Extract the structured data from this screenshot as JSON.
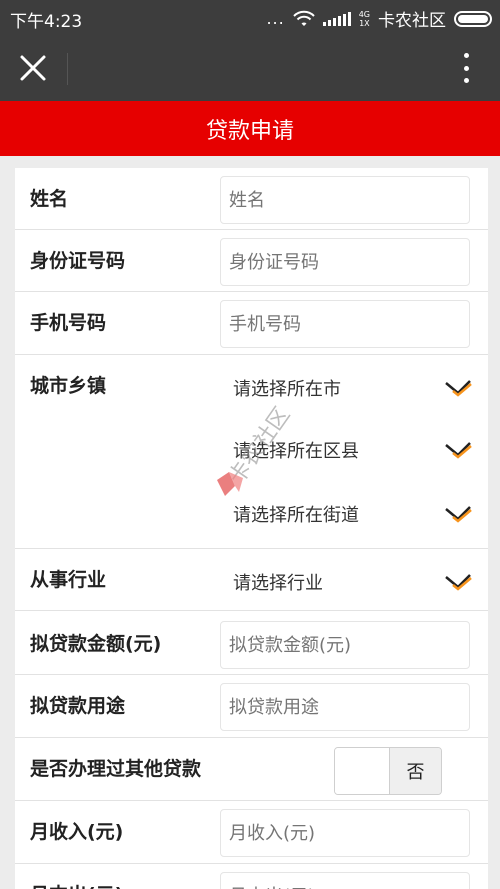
{
  "status": {
    "time": "下午4:23",
    "dots": "...",
    "network_top": "4G",
    "network_bottom": "1X",
    "carrier": "卡农社区"
  },
  "nav": {
    "close_icon": "close-icon",
    "more_icon": "more-vertical-icon"
  },
  "page_title": "贷款申请",
  "fields": {
    "name": {
      "label": "姓名",
      "placeholder": "姓名"
    },
    "id_number": {
      "label": "身份证号码",
      "placeholder": "身份证号码"
    },
    "phone": {
      "label": "手机号码",
      "placeholder": "手机号码"
    },
    "location": {
      "label": "城市乡镇",
      "city": "请选择所在市",
      "district": "请选择所在区县",
      "street": "请选择所在街道"
    },
    "industry": {
      "label": "从事行业",
      "value": "请选择行业"
    },
    "amount": {
      "label": "拟贷款金额(元)",
      "placeholder": "拟贷款金额(元)"
    },
    "purpose": {
      "label": "拟贷款用途",
      "placeholder": "拟贷款用途"
    },
    "other_loans": {
      "label": "是否办理过其他贷款",
      "value": "否"
    },
    "monthly_income": {
      "label": "月收入(元)",
      "placeholder": "月收入(元)"
    },
    "monthly_expense": {
      "label": "月支出(元)",
      "placeholder": "月支出(元)"
    }
  },
  "watermark": "卡农社区",
  "colors": {
    "accent": "#e60000",
    "chevron": "#f7941d",
    "bar": "#3d3d3d"
  }
}
